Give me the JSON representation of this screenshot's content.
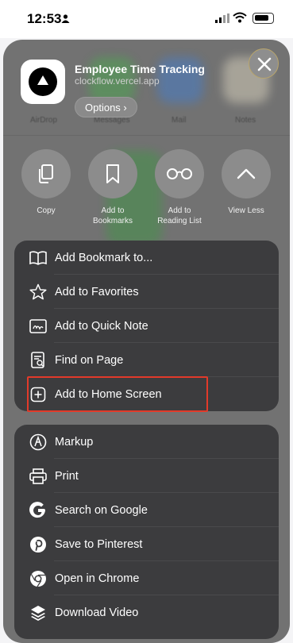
{
  "status_bar": {
    "time": "12:53"
  },
  "share_header": {
    "title": "Employee Time Tracking",
    "url": "clockflow.vercel.app",
    "options_label": "Options ›"
  },
  "background_apps": {
    "airdrop": "AirDrop",
    "messages": "Messages",
    "mail": "Mail",
    "notes": "Notes"
  },
  "actions": [
    {
      "label": "Copy"
    },
    {
      "label": "Add to\nBookmarks"
    },
    {
      "label": "Add to\nReading List"
    },
    {
      "label": "View Less"
    }
  ],
  "menu_group_1": [
    {
      "label": "Add Bookmark to...",
      "icon": "book-icon"
    },
    {
      "label": "Add to Favorites",
      "icon": "star-icon"
    },
    {
      "label": "Add to Quick Note",
      "icon": "quick-note-icon"
    },
    {
      "label": "Find on Page",
      "icon": "find-page-icon"
    },
    {
      "label": "Add to Home Screen",
      "icon": "plus-square-icon"
    }
  ],
  "menu_group_2": [
    {
      "label": "Markup",
      "icon": "markup-icon"
    },
    {
      "label": "Print",
      "icon": "printer-icon"
    },
    {
      "label": "Search on Google",
      "icon": "google-icon"
    },
    {
      "label": "Save to Pinterest",
      "icon": "pinterest-icon"
    },
    {
      "label": "Open in Chrome",
      "icon": "chrome-icon"
    },
    {
      "label": "Download Video",
      "icon": "layers-icon"
    }
  ],
  "colors": {
    "highlight_box": "#e23a2a",
    "sheet": "#727272",
    "group": "#3c3c3e"
  }
}
